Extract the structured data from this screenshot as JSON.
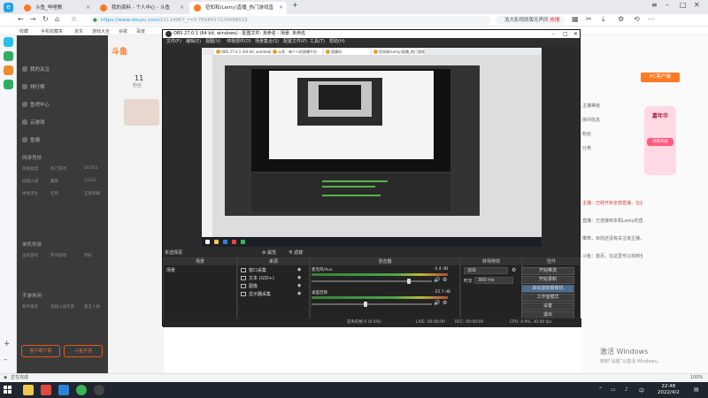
{
  "browser": {
    "tabs": [
      {
        "label": "斗鱼_哔哩教",
        "color": "#ff7a24"
      },
      {
        "label": "我的资料 - 个人中心 - 斗鱼",
        "color": "#ff7a24"
      },
      {
        "label": "莅知和(Lemy)直播_热门游戏直",
        "color": "#ff7a24",
        "active": true
      }
    ],
    "url": "https://www.douyu.com/",
    "url_tail": "21114967_r=0.7658417220698515",
    "search_placeholder": "浩大影视原版无声同",
    "search_hot": "热搜",
    "bookmarks": [
      "收藏",
      "手机收藏夹",
      "京东",
      "游戏大全",
      "谷歌",
      "百度"
    ],
    "status_text": "正在完成",
    "zoom": "100%"
  },
  "douyu": {
    "logo": "斗鱼",
    "fans_count": "11",
    "fans_label": "粉丝",
    "nav_items": [
      "我的关注",
      "排行榜",
      "鱼吧中心",
      "云游戏",
      "鱼塘"
    ],
    "sections": [
      "网游竞技",
      "单机热游",
      "手游休闲"
    ],
    "sub_items": [
      [
        "英雄联盟",
        "热门游戏",
        "DOTA2"
      ],
      [
        "穿越火线",
        "魔兽",
        "CSGO"
      ],
      [
        "绝地求生",
        "吃鸡",
        "王者荣耀"
      ],
      [
        "主机游戏",
        "怀旧游戏",
        "单机"
      ],
      [
        "和平精英",
        "穿越火线手游",
        "第五人格"
      ]
    ],
    "bottom_buttons": [
      "客户端下载",
      "斗鱼手游"
    ],
    "right_texts": [
      "主播等级",
      "房间信息",
      "粉丝",
      "分类"
    ],
    "right_paragraph": [
      "主播：已经开启全部直播，在这里发",
      "直播：已连接到本机Lemy的直播间，可",
      "推荐，目前还没有关注该主播，点击关注",
      "斗鱼：首页，在这里可以找到全部的热门"
    ],
    "pc_button": "PC客户端",
    "promo_title": "嘉年华",
    "promo_button": "领取奖励",
    "activate_title": "激活 Windows",
    "activate_sub": "转到“设置”以激活 Windows。"
  },
  "obs": {
    "title": "OBS 27.0.1 (64 bit, windows) - 配置文件: 未命名 - 场景: 未命名",
    "menu": [
      "文件(F)",
      "编辑(E)",
      "视图(V)",
      "停靠部件(D)",
      "场景集合(S)",
      "配置文件(P)",
      "工具(T)",
      "帮助(H)"
    ],
    "preview_tabs": [
      "OBS 27.0.1 (64 bit, windows)",
      "斗鱼 - 每个人的直播平台",
      "直播间",
      "莅知和(Lemy)直播_热门游戏"
    ],
    "no_source": "未选择源",
    "props_button": "属性",
    "filters_button": "滤镜",
    "scenes_header": "场景",
    "scenes": [
      "场景"
    ],
    "sources_header": "来源",
    "sources": [
      "窗口采集",
      "文本 (GDI+)",
      "图像",
      "显示器采集"
    ],
    "mixer_header": "混音器",
    "mixer": [
      {
        "name": "麦克风/Aux",
        "db": "-5.4 dB",
        "level": 0.82
      },
      {
        "name": "桌面音频",
        "db": "-22.7 dB",
        "level": 0.45
      }
    ],
    "transitions_header": "转场特效",
    "transition_value": "淡出",
    "duration_label": "时长",
    "duration_value": "300 ms",
    "controls_header": "控件",
    "controls": [
      "开始推流",
      "开始录制",
      "启动虚拟摄像机",
      "工作室模式",
      "设置",
      "退出"
    ],
    "status": {
      "dropped": "丢失的帧 0 (0.0%)",
      "live": "LIVE: 00:00:00",
      "rec": "REC: 00:00:00",
      "cpu": "CPU: 4.9%, 30.00 fps"
    }
  },
  "taskbar": {
    "time": "22:48",
    "date": "2022/4/2"
  }
}
